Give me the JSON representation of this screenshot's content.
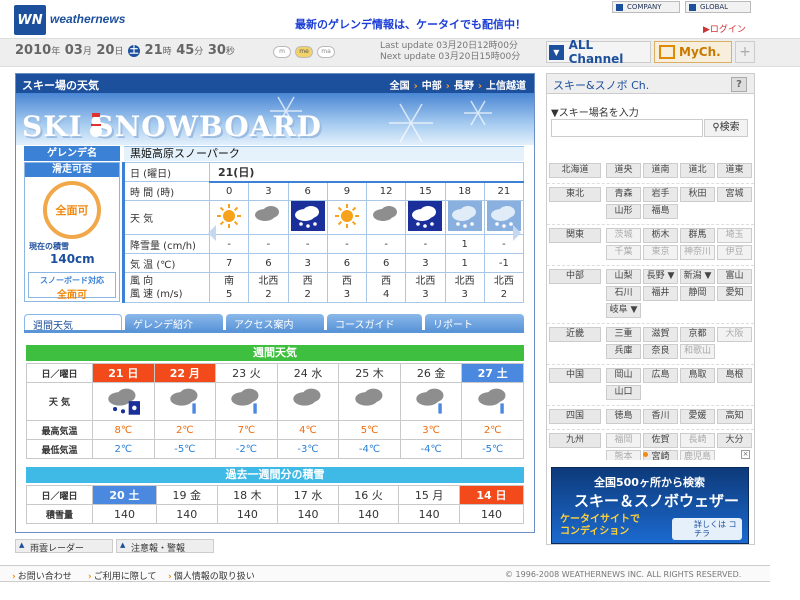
{
  "header": {
    "logo_text": "WN",
    "brand": "weathernews",
    "promo": "最新のゲレンデ情報は、ケータイでも配信中！",
    "company_label": "COMPANY",
    "global_label": "GLOBAL",
    "login_label": "ログイン"
  },
  "dateline": {
    "year": "2010",
    "month": "03",
    "day": "20",
    "weekday": "土",
    "hour": "21",
    "minute": "45",
    "second": "30",
    "u_year": "年",
    "u_month": "月",
    "u_day": "日",
    "u_hour": "時",
    "u_minute": "分",
    "u_second": "秒",
    "size_buttons": [
      "m",
      "me",
      "ma"
    ],
    "last_update_label": "Last update",
    "last_update": "03月20日12時00分",
    "next_update_label": "Next update",
    "next_update": "03月20日15時00分",
    "all_channel": "ALL Channel",
    "mych": "MyCh.",
    "plus": "+"
  },
  "panel": {
    "title": "スキー場の天気",
    "crumbs": [
      "全国",
      "中部",
      "長野",
      "上信越道"
    ],
    "banner_text": "SKI SNOWBOARD",
    "slope_label": "ゲレンデ名",
    "slope_name": "黒姫高原スノーパーク",
    "ski_ok_label": "滑走可否",
    "ski_ok_value": "全面可",
    "depth_label": "現在の積雪",
    "depth_value": "140cm",
    "sb_label": "スノーボード対応",
    "sb_value": "全面可"
  },
  "daily": {
    "date": "21(日)",
    "row_labels": {
      "date": "日 (曜日)",
      "time": "時 間 (時)",
      "weather": "天 気",
      "precip": "降雪量 (cm/h)",
      "temp": "気 温 (℃)",
      "wind": "風 向",
      "wind_speed": "風 速 (m/s)"
    },
    "hours": [
      "0",
      "3",
      "6",
      "9",
      "12",
      "15",
      "18",
      "21"
    ],
    "icons": [
      "sun",
      "cloud",
      "cloud-snow-dark",
      "sun",
      "cloud",
      "cloud-snow-dark",
      "snow",
      "snow"
    ],
    "precip": [
      "-",
      "-",
      "-",
      "-",
      "-",
      "-",
      "1",
      "-"
    ],
    "temp": [
      "7",
      "6",
      "3",
      "6",
      "6",
      "3",
      "1",
      "-1"
    ],
    "wind_dir": [
      "南",
      "北西",
      "西",
      "西",
      "西",
      "北西",
      "北西",
      "北西"
    ],
    "wind_speed": [
      "5",
      "2",
      "2",
      "3",
      "4",
      "3",
      "3",
      "2"
    ]
  },
  "tabs": [
    "週間天気",
    "ゲレンデ紹介",
    "アクセス案内",
    "コースガイド",
    "リポート"
  ],
  "weekly": {
    "title": "週間天気",
    "row_labels": [
      "日／曜日",
      "天 気",
      "最高気温",
      "最低気温"
    ],
    "days": [
      {
        "label": "21 日",
        "style": "red",
        "icon": "cloud-snow",
        "hi": "8℃",
        "lo": "2℃"
      },
      {
        "label": "22 月",
        "style": "red",
        "icon": "cloud-rain",
        "hi": "2℃",
        "lo": "-5℃"
      },
      {
        "label": "23 火",
        "style": "plain",
        "icon": "cloud-rain",
        "hi": "7℃",
        "lo": "-2℃"
      },
      {
        "label": "24 水",
        "style": "plain",
        "icon": "cloud",
        "hi": "4℃",
        "lo": "-3℃"
      },
      {
        "label": "25 木",
        "style": "plain",
        "icon": "cloud",
        "hi": "5℃",
        "lo": "-4℃"
      },
      {
        "label": "26 金",
        "style": "plain",
        "icon": "cloud-rain",
        "hi": "3℃",
        "lo": "-4℃"
      },
      {
        "label": "27 土",
        "style": "blue",
        "icon": "cloud-rain",
        "hi": "2℃",
        "lo": "-5℃"
      }
    ]
  },
  "snowfall": {
    "title": "過去一週間分の積雪",
    "row_labels": [
      "日／曜日",
      "積雪量"
    ],
    "days": [
      {
        "label": "20 土",
        "style": "blue",
        "value": "140"
      },
      {
        "label": "19 金",
        "style": "plain",
        "value": "140"
      },
      {
        "label": "18 木",
        "style": "plain",
        "value": "140"
      },
      {
        "label": "17 水",
        "style": "plain",
        "value": "140"
      },
      {
        "label": "16 火",
        "style": "plain",
        "value": "140"
      },
      {
        "label": "15 月",
        "style": "plain",
        "value": "140"
      },
      {
        "label": "14 日",
        "style": "red",
        "value": "140"
      }
    ]
  },
  "bottom_links": [
    "雨雲レーダー",
    "注意報・警報"
  ],
  "footer": {
    "links": [
      "お問い合わせ",
      "ご利用に際して",
      "個人情報の取り扱い"
    ],
    "copyright": "1996-2008 WEATHERNEWS INC. ALL RIGHTS RESERVED."
  },
  "right": {
    "title": "スキー&スノボ Ch.",
    "help": "?",
    "search_label": "▼スキー場名を入力",
    "search_button": "検索",
    "regions": [
      {
        "name": "北海道",
        "prefs": [
          {
            "n": "道央"
          },
          {
            "n": "道南"
          },
          {
            "n": "道北"
          },
          {
            "n": "道東"
          }
        ]
      },
      {
        "name": "東北",
        "prefs": [
          {
            "n": "青森"
          },
          {
            "n": "岩手"
          },
          {
            "n": "秋田"
          },
          {
            "n": "宮城"
          },
          {
            "n": "山形"
          },
          {
            "n": "福島"
          }
        ]
      },
      {
        "name": "関東",
        "prefs": [
          {
            "n": "茨城",
            "off": true
          },
          {
            "n": "栃木"
          },
          {
            "n": "群馬"
          },
          {
            "n": "埼玉",
            "off": true
          },
          {
            "n": "千葉",
            "off": true
          },
          {
            "n": "東京",
            "off": true
          },
          {
            "n": "神奈川",
            "off": true
          },
          {
            "n": "伊豆",
            "off": true
          }
        ]
      },
      {
        "name": "中部",
        "prefs": [
          {
            "n": "山梨"
          },
          {
            "n": "長野 ▼"
          },
          {
            "n": "新潟 ▼"
          },
          {
            "n": "富山"
          },
          {
            "n": "石川"
          },
          {
            "n": "福井"
          },
          {
            "n": "静岡"
          },
          {
            "n": "愛知"
          },
          {
            "n": "岐阜 ▼"
          }
        ]
      },
      {
        "name": "近畿",
        "prefs": [
          {
            "n": "三重"
          },
          {
            "n": "滋賀"
          },
          {
            "n": "京都"
          },
          {
            "n": "大阪",
            "off": true
          },
          {
            "n": "兵庫"
          },
          {
            "n": "奈良"
          },
          {
            "n": "和歌山",
            "off": true
          }
        ]
      },
      {
        "name": "中国",
        "prefs": [
          {
            "n": "岡山"
          },
          {
            "n": "広島"
          },
          {
            "n": "鳥取"
          },
          {
            "n": "島根"
          },
          {
            "n": "山口"
          }
        ]
      },
      {
        "name": "四国",
        "prefs": [
          {
            "n": "徳島"
          },
          {
            "n": "香川"
          },
          {
            "n": "愛媛"
          },
          {
            "n": "高知"
          }
        ]
      },
      {
        "name": "九州",
        "prefs": [
          {
            "n": "福岡",
            "off": true
          },
          {
            "n": "佐賀"
          },
          {
            "n": "長崎",
            "off": true
          },
          {
            "n": "大分"
          },
          {
            "n": "熊本",
            "off": true
          },
          {
            "n": "宮崎"
          },
          {
            "n": "鹿児島",
            "off": true
          }
        ]
      }
    ],
    "ad": {
      "line1": "全国500ヶ所から検索",
      "line2": "スキー＆スノボウェザー",
      "line3": "ケータイサイトで",
      "line4": "コンディション",
      "button": "詳しくは コチラ"
    }
  },
  "colors": {
    "brand": "#1c4f9c",
    "accent": "#f08a10",
    "green": "#3fbf3f",
    "cyan": "#3fb9e6",
    "red": "#f24a1a"
  }
}
